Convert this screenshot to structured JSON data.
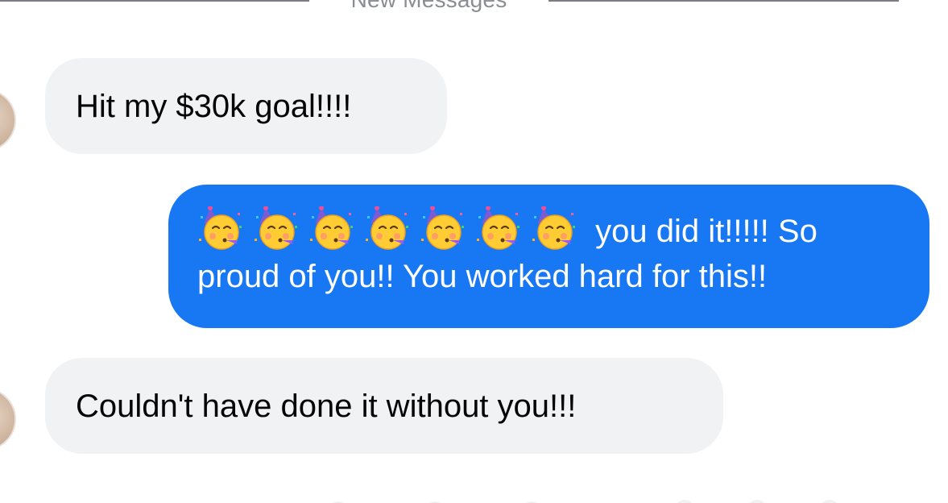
{
  "divider": {
    "label": "New Messages"
  },
  "messages": [
    {
      "direction": "incoming",
      "text": "Hit my $30k goal!!!!"
    },
    {
      "direction": "outgoing",
      "emoji": "partying-face-emoji",
      "emoji_count": 7,
      "text": "you did it!!!!! So proud of you!! You worked hard for this!!"
    },
    {
      "direction": "incoming",
      "text": "Couldn't have done it without you!!!"
    }
  ],
  "colors": {
    "outgoing_bubble": "#1877f2",
    "incoming_bubble": "#f1f2f4",
    "divider": "#7a7d84"
  }
}
